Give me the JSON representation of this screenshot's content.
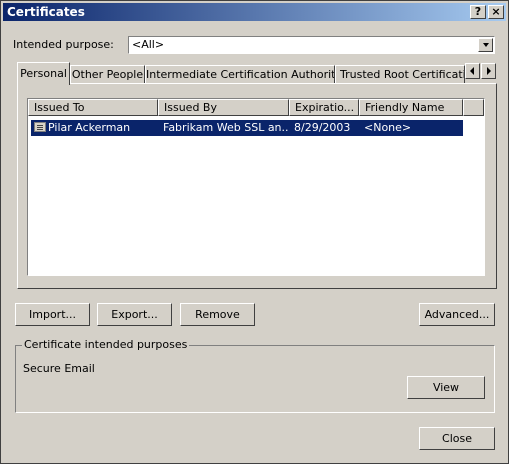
{
  "window": {
    "title": "Certificates",
    "help_glyph": "?",
    "close_glyph": "×"
  },
  "purpose": {
    "label": "Intended purpose:",
    "value": "<All>"
  },
  "tabs": [
    {
      "label": "Personal"
    },
    {
      "label": "Other People"
    },
    {
      "label": "Intermediate Certification Authorities"
    },
    {
      "label": "Trusted Root Certification"
    }
  ],
  "table": {
    "columns": [
      "Issued To",
      "Issued By",
      "Expiratio...",
      "Friendly Name"
    ],
    "rows": [
      {
        "issued_to": "Pilar Ackerman",
        "issued_by": "Fabrikam Web SSL an...",
        "expiration": "8/29/2003",
        "friendly_name": "<None>"
      }
    ]
  },
  "buttons": {
    "import": "Import...",
    "export": "Export...",
    "remove": "Remove",
    "advanced": "Advanced...",
    "view": "View",
    "close": "Close"
  },
  "purposes_group": {
    "label": "Certificate intended purposes",
    "value": "Secure Email"
  }
}
